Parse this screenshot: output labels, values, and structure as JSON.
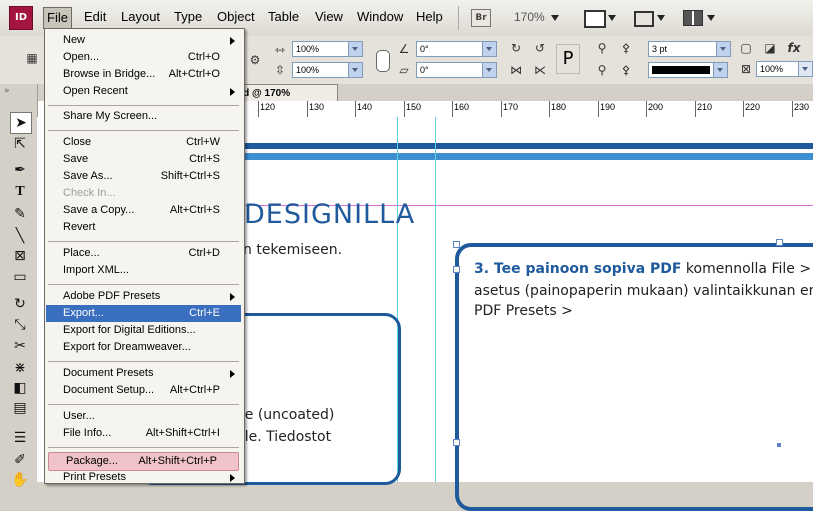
{
  "app": {
    "logo": "ID"
  },
  "menubar": {
    "items": [
      "File",
      "Edit",
      "Layout",
      "Type",
      "Object",
      "Table",
      "View",
      "Window",
      "Help"
    ],
    "bridge": "Br",
    "zoom": "170%"
  },
  "control": {
    "scale_x": "100%",
    "scale_y": "100%",
    "rotate": "0°",
    "shear": "0°",
    "stroke_weight": "3 pt",
    "opacity": "100%"
  },
  "document": {
    "tab": "dd @ 170%"
  },
  "ruler": {
    "labels": [
      "120",
      "130",
      "140",
      "150",
      "160",
      "170",
      "180",
      "190",
      "200",
      "210",
      "220",
      "230"
    ]
  },
  "canvas": {
    "heading": "DESIGNILLA",
    "line1": "n tekemiseen.",
    "box_line1": "lle (uncoated)",
    "box_line2": "ille. Tiedostot",
    "right_bold": "3. Tee painoon sopiva PDF",
    "right_rest1": " komennolla File > Exp",
    "right_line2": "asetus (painopaperin mukaan) valintaikkunan en",
    "right_line3": "PDF Presets >"
  },
  "file_menu": {
    "items": [
      {
        "label": "New",
        "shortcut": "",
        "submenu": true
      },
      {
        "label": "Open...",
        "shortcut": "Ctrl+O"
      },
      {
        "label": "Browse in Bridge...",
        "shortcut": "Alt+Ctrl+O"
      },
      {
        "label": "Open Recent",
        "shortcut": "",
        "submenu": true
      },
      {
        "label": "Share My Screen...",
        "shortcut": ""
      },
      {
        "label": "Close",
        "shortcut": "Ctrl+W"
      },
      {
        "label": "Save",
        "shortcut": "Ctrl+S"
      },
      {
        "label": "Save As...",
        "shortcut": "Shift+Ctrl+S"
      },
      {
        "label": "Check In...",
        "shortcut": "",
        "disabled": true
      },
      {
        "label": "Save a Copy...",
        "shortcut": "Alt+Ctrl+S"
      },
      {
        "label": "Revert",
        "shortcut": ""
      },
      {
        "label": "Place...",
        "shortcut": "Ctrl+D"
      },
      {
        "label": "Import XML...",
        "shortcut": ""
      },
      {
        "label": "Adobe PDF Presets",
        "shortcut": "",
        "submenu": true
      },
      {
        "label": "Export...",
        "shortcut": "Ctrl+E",
        "highlighted": true
      },
      {
        "label": "Export for Digital Editions...",
        "shortcut": ""
      },
      {
        "label": "Export for Dreamweaver...",
        "shortcut": ""
      },
      {
        "label": "Document Presets",
        "shortcut": "",
        "submenu": true
      },
      {
        "label": "Document Setup...",
        "shortcut": "Alt+Ctrl+P"
      },
      {
        "label": "User...",
        "shortcut": ""
      },
      {
        "label": "File Info...",
        "shortcut": "Alt+Shift+Ctrl+I"
      },
      {
        "label": "Package...",
        "shortcut": "Alt+Shift+Ctrl+P",
        "marked": true
      },
      {
        "label": "Print Presets",
        "shortcut": "",
        "submenu": true
      }
    ]
  },
  "colors": {
    "accent_blue": "#1e5a9c",
    "guide_cyan": "#5fd3e0",
    "menu_highlight": "#3a6ebf",
    "package_mark": "#efc3c8"
  }
}
